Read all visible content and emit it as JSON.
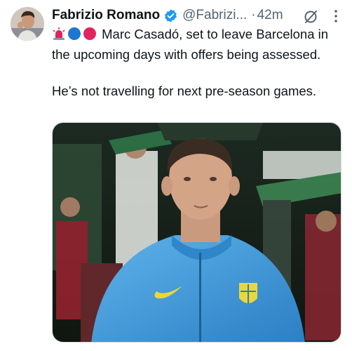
{
  "author": {
    "name": "Fabrizio Romano",
    "handle": "@Fabrizi...",
    "separator": "·",
    "time": "42m"
  },
  "tweet": {
    "emojis": [
      "rotating-light",
      "blue-circle",
      "red-circle"
    ],
    "line1": "Marc Casadó, set to leave Barcelona in the upcoming days with offers being assessed.",
    "line2": "He’s not travelling for next pre-season games."
  },
  "colors": {
    "verified_blue": "#1d9bf0",
    "text": "#0f1419",
    "muted": "#536471",
    "jacket_blue": "#3a9ad9",
    "crowd_green": "#2f5a3a"
  }
}
